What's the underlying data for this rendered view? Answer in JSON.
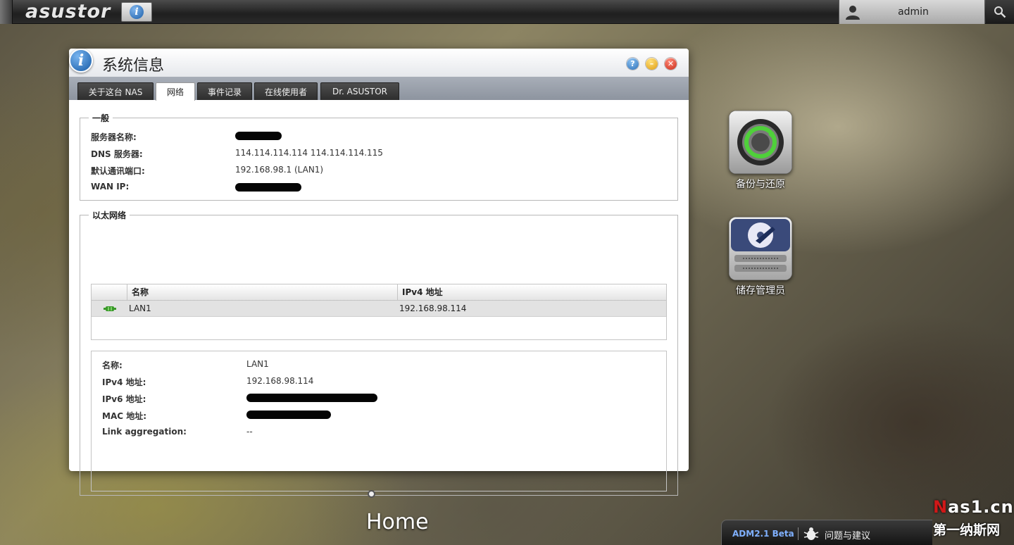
{
  "topbar": {
    "brand": "asustor",
    "username": "admin"
  },
  "window": {
    "title": "系统信息",
    "tabs": [
      "关于这台 NAS",
      "网络",
      "事件记录",
      "在线使用者",
      "Dr. ASUSTOR"
    ],
    "active_tab": "网络",
    "general": {
      "legend": "一般",
      "rows": [
        {
          "label": "服务器名称:",
          "value": "",
          "redacted": true
        },
        {
          "label": "DNS 服务器:",
          "value": "114.114.114.114 114.114.114.115",
          "redacted": false
        },
        {
          "label": "默认通讯端口:",
          "value": "192.168.98.1 (LAN1)",
          "redacted": false
        },
        {
          "label": "WAN IP:",
          "value": "",
          "redacted": true
        }
      ]
    },
    "ethernet": {
      "legend": "以太网络",
      "columns": [
        "名称",
        "IPv4 地址"
      ],
      "rows": [
        {
          "name": "LAN1",
          "ipv4": "192.168.98.114"
        }
      ],
      "details": [
        {
          "label": "名称:",
          "value": "LAN1",
          "redacted": false
        },
        {
          "label": "IPv4 地址:",
          "value": "192.168.98.114",
          "redacted": false
        },
        {
          "label": "IPv6 地址:",
          "value": "",
          "redacted": true
        },
        {
          "label": "MAC 地址:",
          "value": "",
          "redacted": true
        },
        {
          "label": "Link aggregation:",
          "value": "--",
          "redacted": false
        }
      ]
    }
  },
  "desktop": {
    "icons": [
      {
        "label": "备份与还原",
        "icon": "backup-restore-icon"
      },
      {
        "label": "储存管理员",
        "icon": "storage-manager-icon"
      }
    ],
    "page_label": "Home"
  },
  "footer": {
    "version": "ADM2.1 Beta",
    "feedback": "问题与建议"
  },
  "watermark": {
    "line1_accent": "N",
    "line1_rest": "as1.cn",
    "line2": "第一纳斯网"
  },
  "colors": {
    "accent_blue": "#1d5fa8",
    "close_red": "#c92a16",
    "minimize_yellow": "#e09d10",
    "watermark_red": "#d01818"
  }
}
